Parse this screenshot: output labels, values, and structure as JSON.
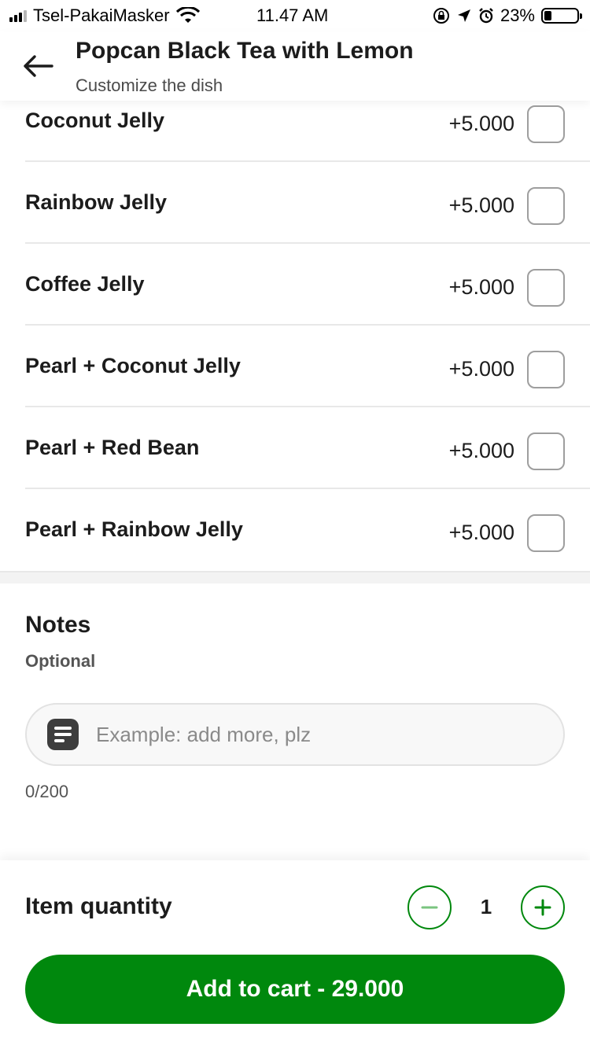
{
  "status_bar": {
    "carrier": "Tsel-PakaiMasker",
    "time": "11.47 AM",
    "battery": "23%",
    "battery_level": 0.23
  },
  "header": {
    "title": "Popcan Black Tea with Lemon",
    "subtitle": "Customize the dish",
    "back_icon": "arrow-left-icon"
  },
  "addons": [
    {
      "name": "Coconut Jelly",
      "price": "+5.000",
      "checked": false
    },
    {
      "name": "Rainbow Jelly",
      "price": "+5.000",
      "checked": false
    },
    {
      "name": "Coffee Jelly",
      "price": "+5.000",
      "checked": false
    },
    {
      "name": "Pearl + Coconut Jelly",
      "price": "+5.000",
      "checked": false
    },
    {
      "name": "Pearl + Red Bean",
      "price": "+5.000",
      "checked": false
    },
    {
      "name": "Pearl + Rainbow Jelly",
      "price": "+5.000",
      "checked": false
    }
  ],
  "notes": {
    "title": "Notes",
    "subtitle": "Optional",
    "placeholder": "Example: add more, plz",
    "value": "",
    "counter": "0/200",
    "icon": "note-icon"
  },
  "quantity": {
    "label": "Item quantity",
    "value": "1",
    "minus_icon": "minus-icon",
    "plus_icon": "plus-icon"
  },
  "cart_button": {
    "label": "Add to cart - 29.000"
  },
  "colors": {
    "accent": "#00880d",
    "text": "#1c1c1c",
    "divider": "#e8e8e8"
  }
}
